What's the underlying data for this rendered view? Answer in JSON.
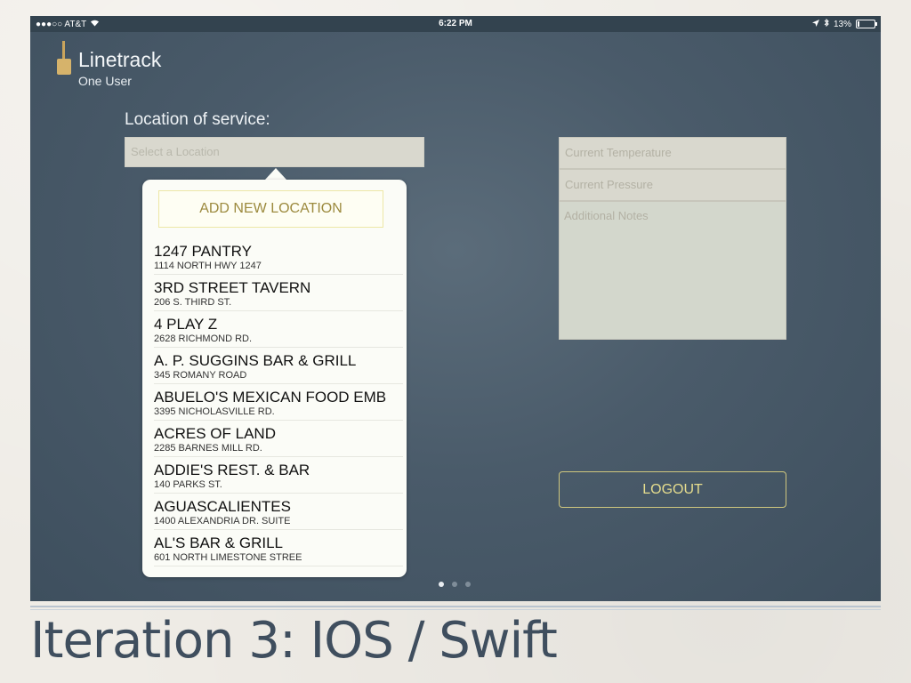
{
  "status_bar": {
    "carrier": "●●●○○ AT&T",
    "wifi_icon": "wifi-icon",
    "time": "6:22 PM",
    "location_icon": "location-arrow-icon",
    "bluetooth_icon": "bluetooth-icon",
    "battery_text": "13%",
    "battery_level": 0.13
  },
  "header": {
    "title": "Linetrack",
    "subtitle": "One User"
  },
  "location": {
    "label": "Location of service:",
    "placeholder": "Select a Location"
  },
  "popover": {
    "add_button": "ADD NEW LOCATION",
    "items": [
      {
        "name": "1247 PANTRY",
        "address": "1114 NORTH HWY 1247"
      },
      {
        "name": "3RD STREET TAVERN",
        "address": "206 S. THIRD ST."
      },
      {
        "name": "4 PLAY Z",
        "address": "2628 RICHMOND RD."
      },
      {
        "name": "A. P. SUGGINS BAR & GRILL",
        "address": "345 ROMANY ROAD"
      },
      {
        "name": "ABUELO'S MEXICAN FOOD EMB",
        "address": "3395 NICHOLASVILLE RD."
      },
      {
        "name": "ACRES OF LAND",
        "address": "2285 BARNES MILL RD."
      },
      {
        "name": "ADDIE'S REST. & BAR",
        "address": "140 PARKS ST."
      },
      {
        "name": "AGUASCALIENTES",
        "address": "1400 ALEXANDRIA DR. SUITE"
      },
      {
        "name": "AL'S BAR & GRILL",
        "address": "601 NORTH LIMESTONE STREE"
      }
    ]
  },
  "form": {
    "temperature_placeholder": "Current Temperature",
    "pressure_placeholder": "Current Pressure",
    "notes_placeholder": "Additional Notes"
  },
  "logout_label": "LOGOUT",
  "pager": {
    "pages": 3,
    "current": 1
  },
  "slide_caption": "Iteration 3: IOS / Swift",
  "colors": {
    "background": "#4a5b6a",
    "accent_gold": "#e6dd8e",
    "add_button_text": "#9c8a3e"
  }
}
